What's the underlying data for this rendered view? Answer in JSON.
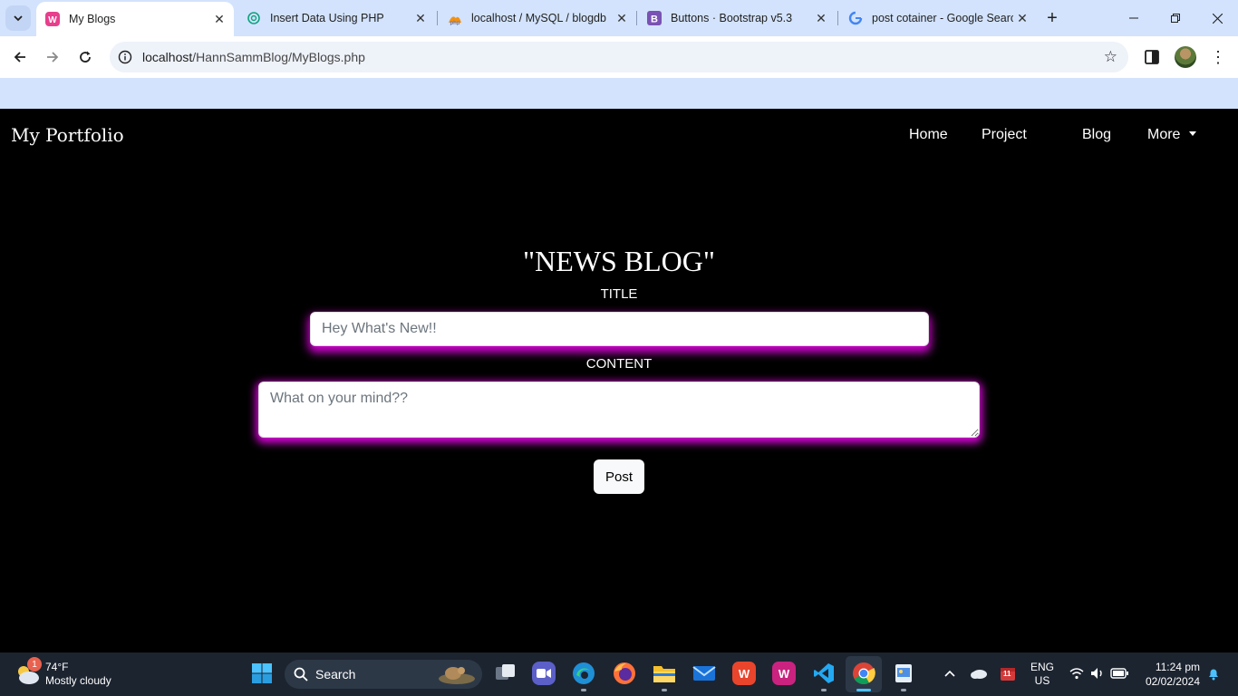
{
  "browser": {
    "tabs": [
      {
        "title": "My Blogs",
        "active": true
      },
      {
        "title": "Insert Data Using PHP",
        "active": false
      },
      {
        "title": "localhost / MySQL / blogdb",
        "active": false
      },
      {
        "title": "Buttons · Bootstrap v5.3",
        "active": false
      },
      {
        "title": "post cotainer - Google Search",
        "active": false
      }
    ],
    "url_host": "localhost",
    "url_path": "/HannSammBlog/MyBlogs.php"
  },
  "page": {
    "brand": "My Portfolio",
    "nav": {
      "home": "Home",
      "project": "Project",
      "blog": "Blog",
      "more": "More"
    },
    "heading": "\"NEWS BLOG\"",
    "title_label": "TITLE",
    "title_placeholder": "Hey What's New!!",
    "content_label": "CONTENT",
    "content_placeholder": "What on your mind??",
    "post_button": "Post",
    "glow_color": "#d100d1"
  },
  "taskbar": {
    "weather_temp": "74°F",
    "weather_condition": "Mostly cloudy",
    "weather_badge": "1",
    "search_label": "Search",
    "lang_top": "ENG",
    "lang_bottom": "US",
    "calendar_badge": "11",
    "time": "11:24 pm",
    "date": "02/02/2024"
  }
}
